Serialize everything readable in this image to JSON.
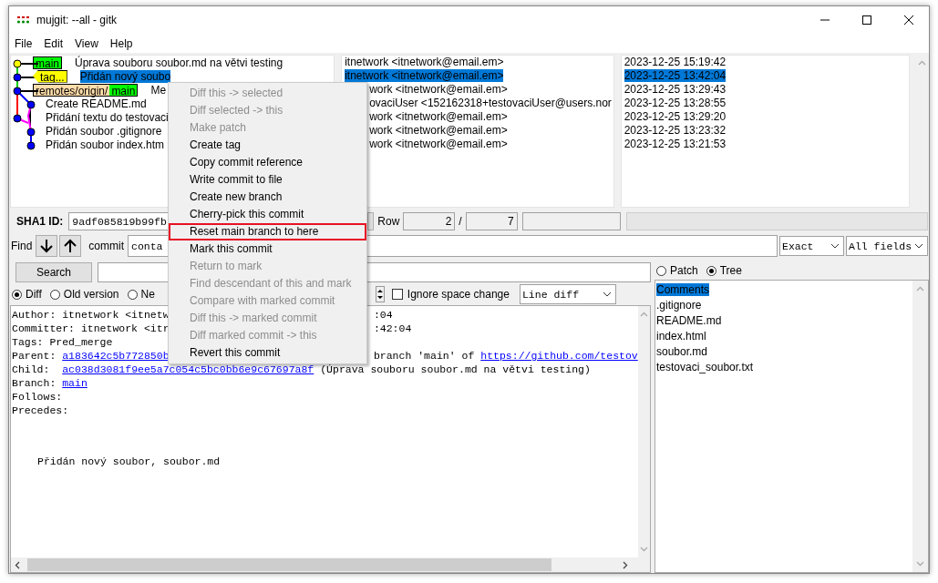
{
  "window": {
    "title": "mujgit: --all - gitk"
  },
  "menu_bar": [
    "File",
    "Edit",
    "View",
    "Help"
  ],
  "commits": [
    {
      "refs": [
        {
          "kind": "head",
          "name": "main"
        }
      ],
      "subject": "Úprava souboru soubor.md na větvi testing",
      "author": "itnetwork <itnetwork@email.em>",
      "date": "2023-12-25 15:19:42",
      "selected": false
    },
    {
      "refs": [
        {
          "kind": "tag",
          "name": "tag..."
        }
      ],
      "subject": "Přidán nový soubo",
      "author": "itnetwork <itnetwork@email.em>",
      "date": "2023-12-25 13:42:04",
      "selected": true
    },
    {
      "refs": [
        {
          "kind": "remote",
          "prefix": "remotes/origin/",
          "name": "main"
        }
      ],
      "subject": "Me",
      "author": "work <itnetwork@email.em>",
      "date": "2023-12-25 13:29:43",
      "selected": false
    },
    {
      "subject": "Create README.md",
      "author": "ovaciUser <152162318+testovaciUser@users.nor",
      "date": "2023-12-25 13:28:55",
      "selected": false
    },
    {
      "subject": "Přidání textu do testovaci",
      "author": "work <itnetwork@email.em>",
      "date": "2023-12-25 13:29:20",
      "selected": false
    },
    {
      "subject": "Přidán soubor .gitignore",
      "author": "work <itnetwork@email.em>",
      "date": "2023-12-25 13:23:32",
      "selected": false
    },
    {
      "subject": "Přidán soubor index.htm",
      "author": "work <itnetwork@email.em>",
      "date": "2023-12-25 13:21:53",
      "selected": false
    }
  ],
  "sha1": {
    "label": "SHA1 ID:",
    "value": "9adf085819b99fb"
  },
  "row_counter": {
    "label": "Row",
    "current": "2",
    "separator": "/",
    "total": "7"
  },
  "find": {
    "label": "Find",
    "type": "commit",
    "mode": "conta",
    "match": "Exact",
    "fields": "All fields"
  },
  "search": {
    "button": "Search"
  },
  "diff_modes": [
    {
      "label": "Diff",
      "selected": true
    },
    {
      "label": "Old version",
      "selected": false
    },
    {
      "label": "Ne",
      "selected": false
    }
  ],
  "ignore_space": {
    "label": "Ignore space change",
    "checked": false
  },
  "diff_style": "Line diff",
  "details": [
    {
      "parts": [
        {
          "text": "Author: itnetwork <itnetw",
          "link": false
        }
      ],
      "tail": [
        {
          "text": ":04",
          "link": false
        }
      ]
    },
    {
      "parts": [
        {
          "text": "Committer: itnetwork <itr",
          "link": false
        }
      ],
      "tail": [
        {
          "text": ":42:04",
          "link": false
        }
      ]
    },
    {
      "parts": [
        {
          "text": "Tags: Pred_merge",
          "link": false
        }
      ]
    },
    {
      "parts": [
        {
          "text": "Parent:",
          "link": false
        },
        {
          "text": "a183642c5b772850b",
          "link": true
        }
      ],
      "tail": [
        {
          "text": "branch 'main' of",
          "link": false
        },
        {
          "text": "https://github.com/testov",
          "link": true
        }
      ]
    },
    {
      "parts": [
        {
          "text": "Child: ",
          "link": false
        },
        {
          "text": "ac038d3081f9ee5a7c054c5bc0bb6e9c67697a8f",
          "link": true
        },
        {
          "text": "(Úprava souboru soubor.md na větvi testing)",
          "link": false
        }
      ]
    },
    {
      "parts": [
        {
          "text": "Branch:",
          "link": false
        },
        {
          "text": "main",
          "link": true
        }
      ]
    },
    {
      "parts": [
        {
          "text": "Follows:",
          "link": false
        }
      ]
    },
    {
      "parts": [
        {
          "text": "Precedes:",
          "link": false
        }
      ]
    }
  ],
  "message": "Přidán nový soubor, soubor.md",
  "file_modes": [
    {
      "label": "Patch",
      "selected": false
    },
    {
      "label": "Tree",
      "selected": true
    }
  ],
  "files": [
    {
      "name": "Comments",
      "selected": true
    },
    {
      "name": ".gitignore",
      "selected": false
    },
    {
      "name": "README.md",
      "selected": false
    },
    {
      "name": "index.html",
      "selected": false
    },
    {
      "name": "soubor.md",
      "selected": false
    },
    {
      "name": "testovaci_soubor.txt",
      "selected": false
    }
  ],
  "context_menu": [
    {
      "label": "Diff this -> selected",
      "disabled": true,
      "highlighted": false
    },
    {
      "label": "Diff selected -> this",
      "disabled": true,
      "highlighted": false
    },
    {
      "label": "Make patch",
      "disabled": true,
      "highlighted": false
    },
    {
      "label": "Create tag",
      "disabled": false,
      "highlighted": false
    },
    {
      "label": "Copy commit reference",
      "disabled": false,
      "highlighted": false
    },
    {
      "label": "Write commit to file",
      "disabled": false,
      "highlighted": false
    },
    {
      "label": "Create new branch",
      "disabled": false,
      "highlighted": false
    },
    {
      "label": "Cherry-pick this commit",
      "disabled": false,
      "highlighted": false
    },
    {
      "label": "Reset main branch to here",
      "disabled": false,
      "highlighted": true
    },
    {
      "label": "Mark this commit",
      "disabled": false,
      "highlighted": false
    },
    {
      "label": "Return to mark",
      "disabled": true,
      "highlighted": false
    },
    {
      "label": "Find descendant of this and mark",
      "disabled": true,
      "highlighted": false
    },
    {
      "label": "Compare with marked commit",
      "disabled": true,
      "highlighted": false
    },
    {
      "label": "Diff this -> marked commit",
      "disabled": true,
      "highlighted": false
    },
    {
      "label": "Diff marked commit -> this",
      "disabled": true,
      "highlighted": false
    },
    {
      "label": "Revert this commit",
      "disabled": false,
      "highlighted": false
    }
  ]
}
